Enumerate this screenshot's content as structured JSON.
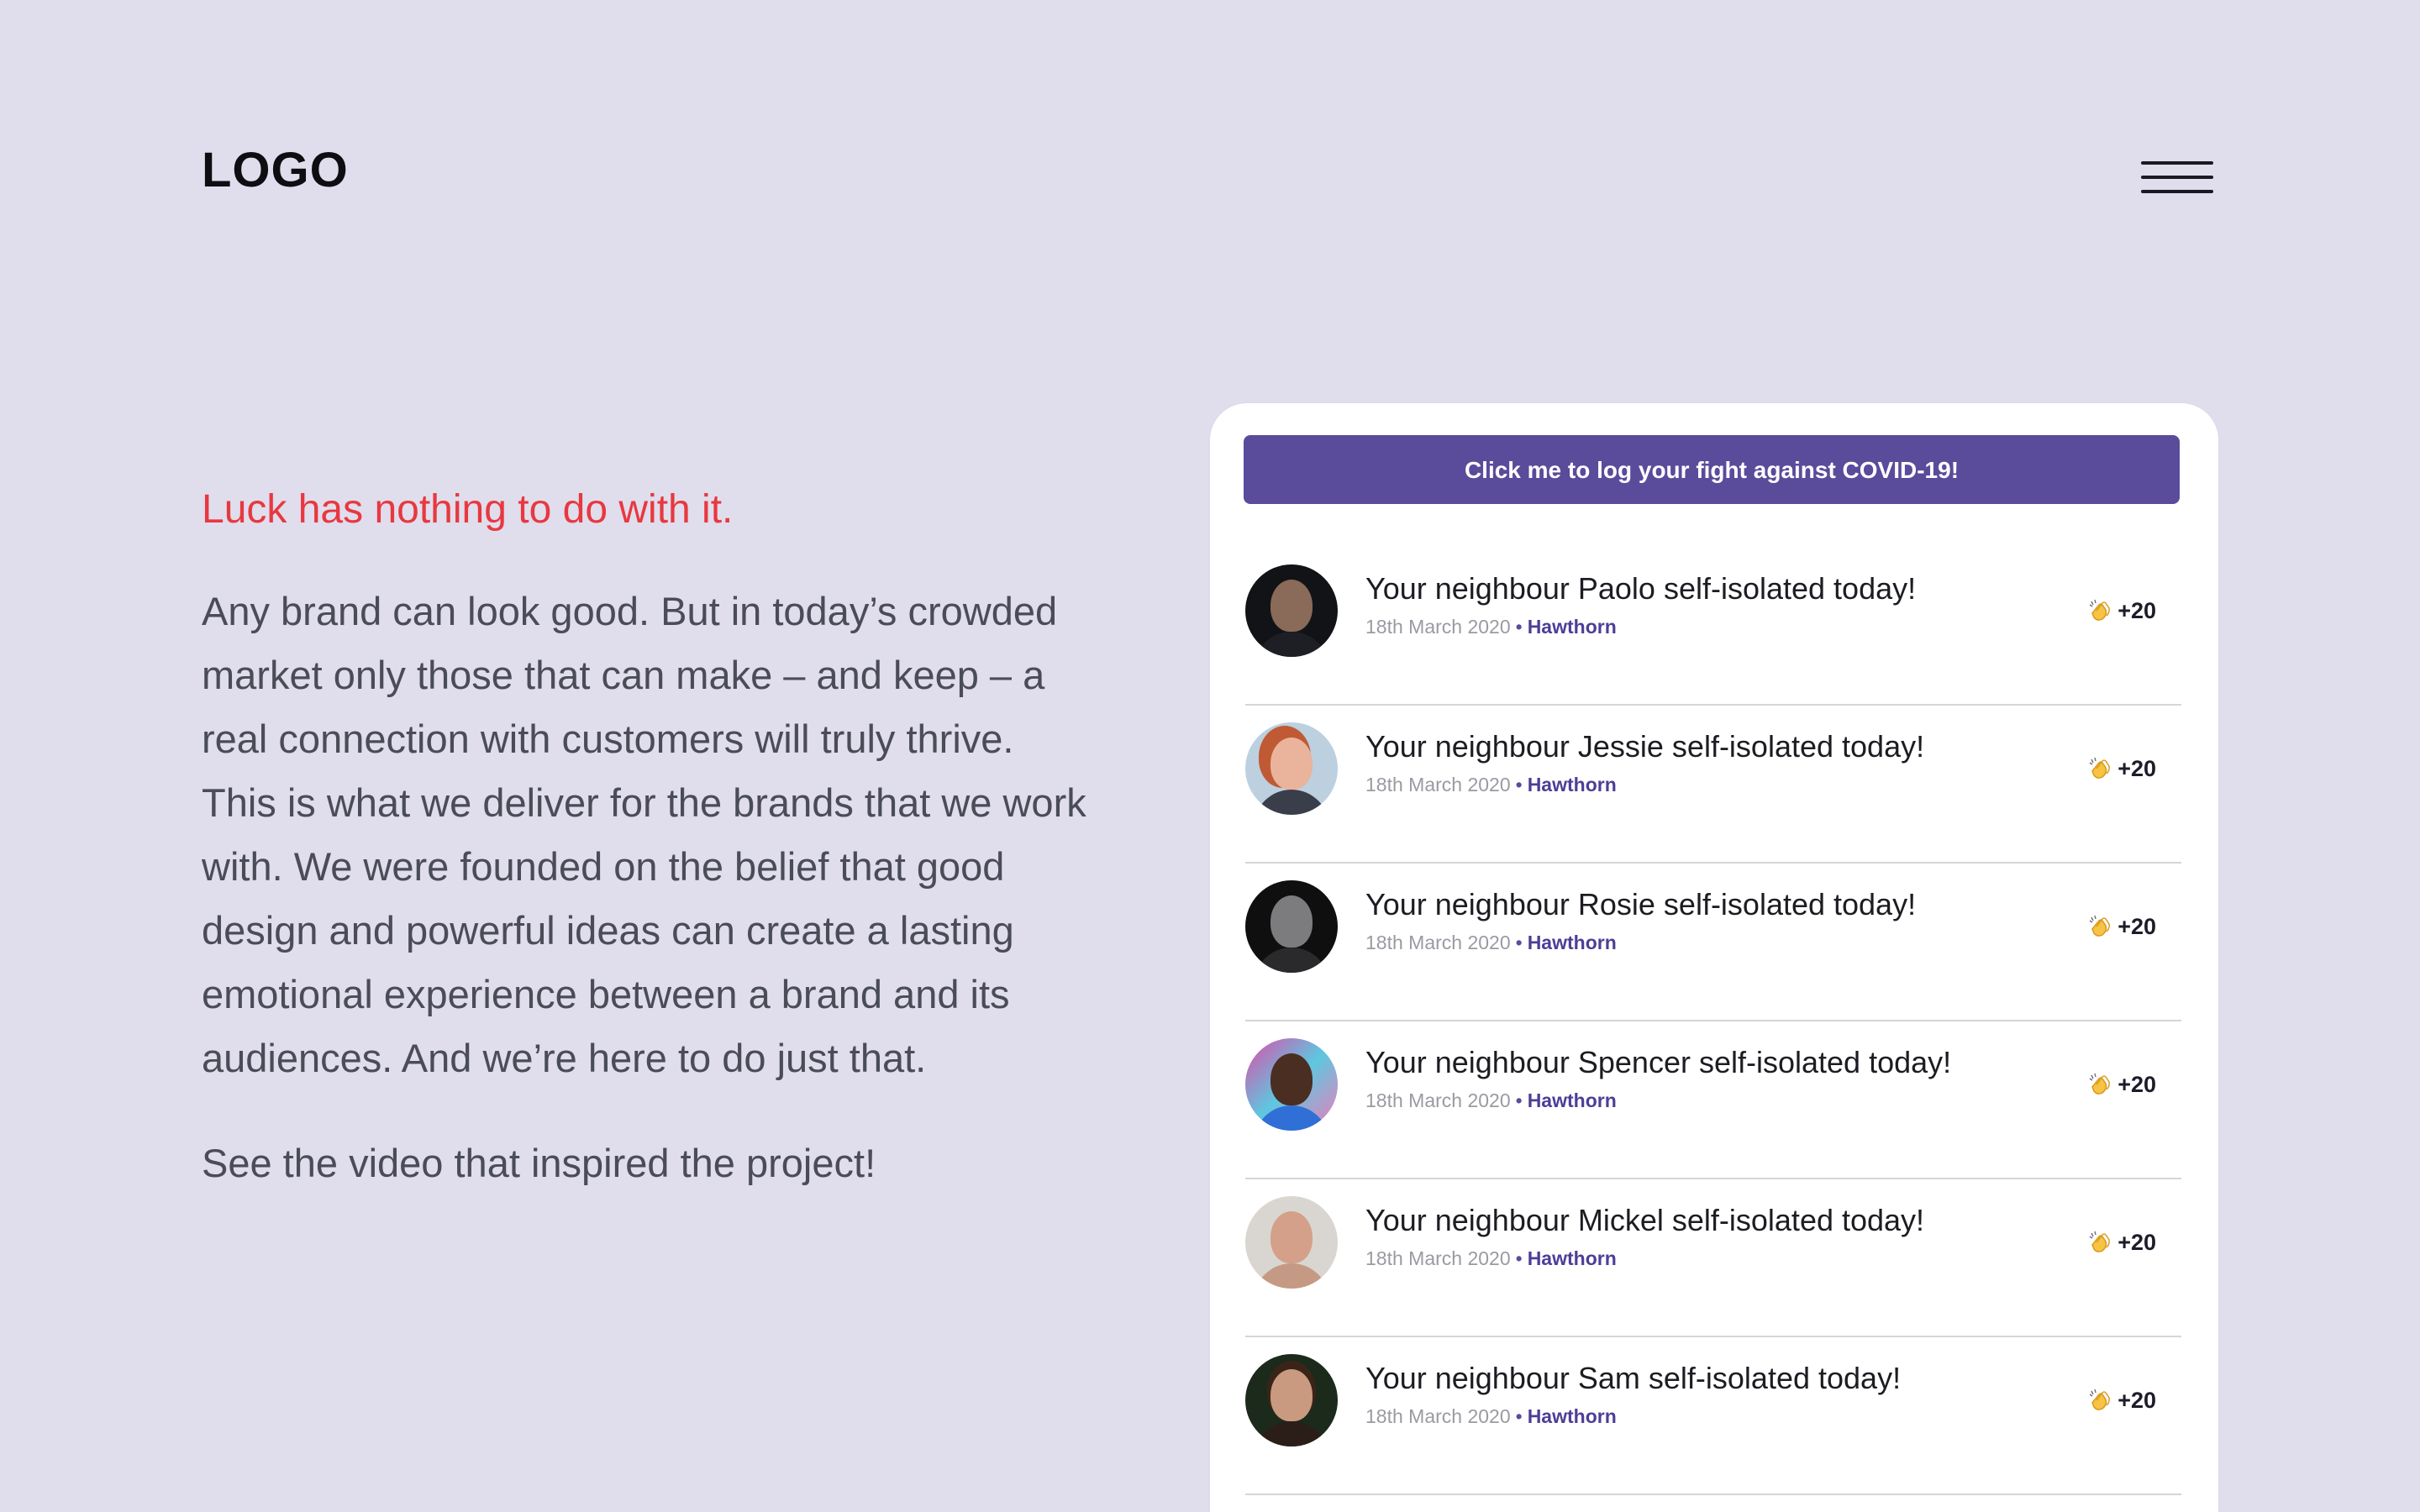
{
  "header": {
    "logo": "LOGO",
    "menu_icon": "hamburger-menu-icon"
  },
  "intro": {
    "tagline": "Luck has nothing to do with it.",
    "body": "Any brand can look good. But in today’s crowded market only those that can make – and keep – a real connection with customers will truly thrive. This is what we deliver for the brands that we work with. We were founded on the belief that good design and powerful ideas can create a lasting emotional experience between a brand and its audiences. And we’re here to do just that.",
    "video_link": "See the video that inspired the project!"
  },
  "colors": {
    "background": "#e0dded",
    "accent": "#5b4b9b",
    "tagline": "#e8383f"
  },
  "feed": {
    "cta_label": "Click me to log your fight against COVID-19!",
    "items": [
      {
        "title": "Your neighbour Paolo self-isolated today!",
        "date": "18th March 2020",
        "separator": "•",
        "place": "Hawthorn",
        "claps": "+20",
        "clap_icon": "clapping-hands-icon"
      },
      {
        "title": "Your neighbour Jessie self-isolated today!",
        "date": "18th March 2020",
        "separator": "•",
        "place": "Hawthorn",
        "claps": "+20",
        "clap_icon": "clapping-hands-icon"
      },
      {
        "title": "Your neighbour Rosie self-isolated today!",
        "date": "18th March 2020",
        "separator": "•",
        "place": "Hawthorn",
        "claps": "+20",
        "clap_icon": "clapping-hands-icon"
      },
      {
        "title": "Your neighbour Spencer self-isolated today!",
        "date": "18th March 2020",
        "separator": "•",
        "place": "Hawthorn",
        "claps": "+20",
        "clap_icon": "clapping-hands-icon"
      },
      {
        "title": "Your neighbour Mickel self-isolated today!",
        "date": "18th March 2020",
        "separator": "•",
        "place": "Hawthorn",
        "claps": "+20",
        "clap_icon": "clapping-hands-icon"
      },
      {
        "title": "Your neighbour Sam self-isolated today!",
        "date": "18th March 2020",
        "separator": "•",
        "place": "Hawthorn",
        "claps": "+20",
        "clap_icon": "clapping-hands-icon"
      }
    ]
  }
}
